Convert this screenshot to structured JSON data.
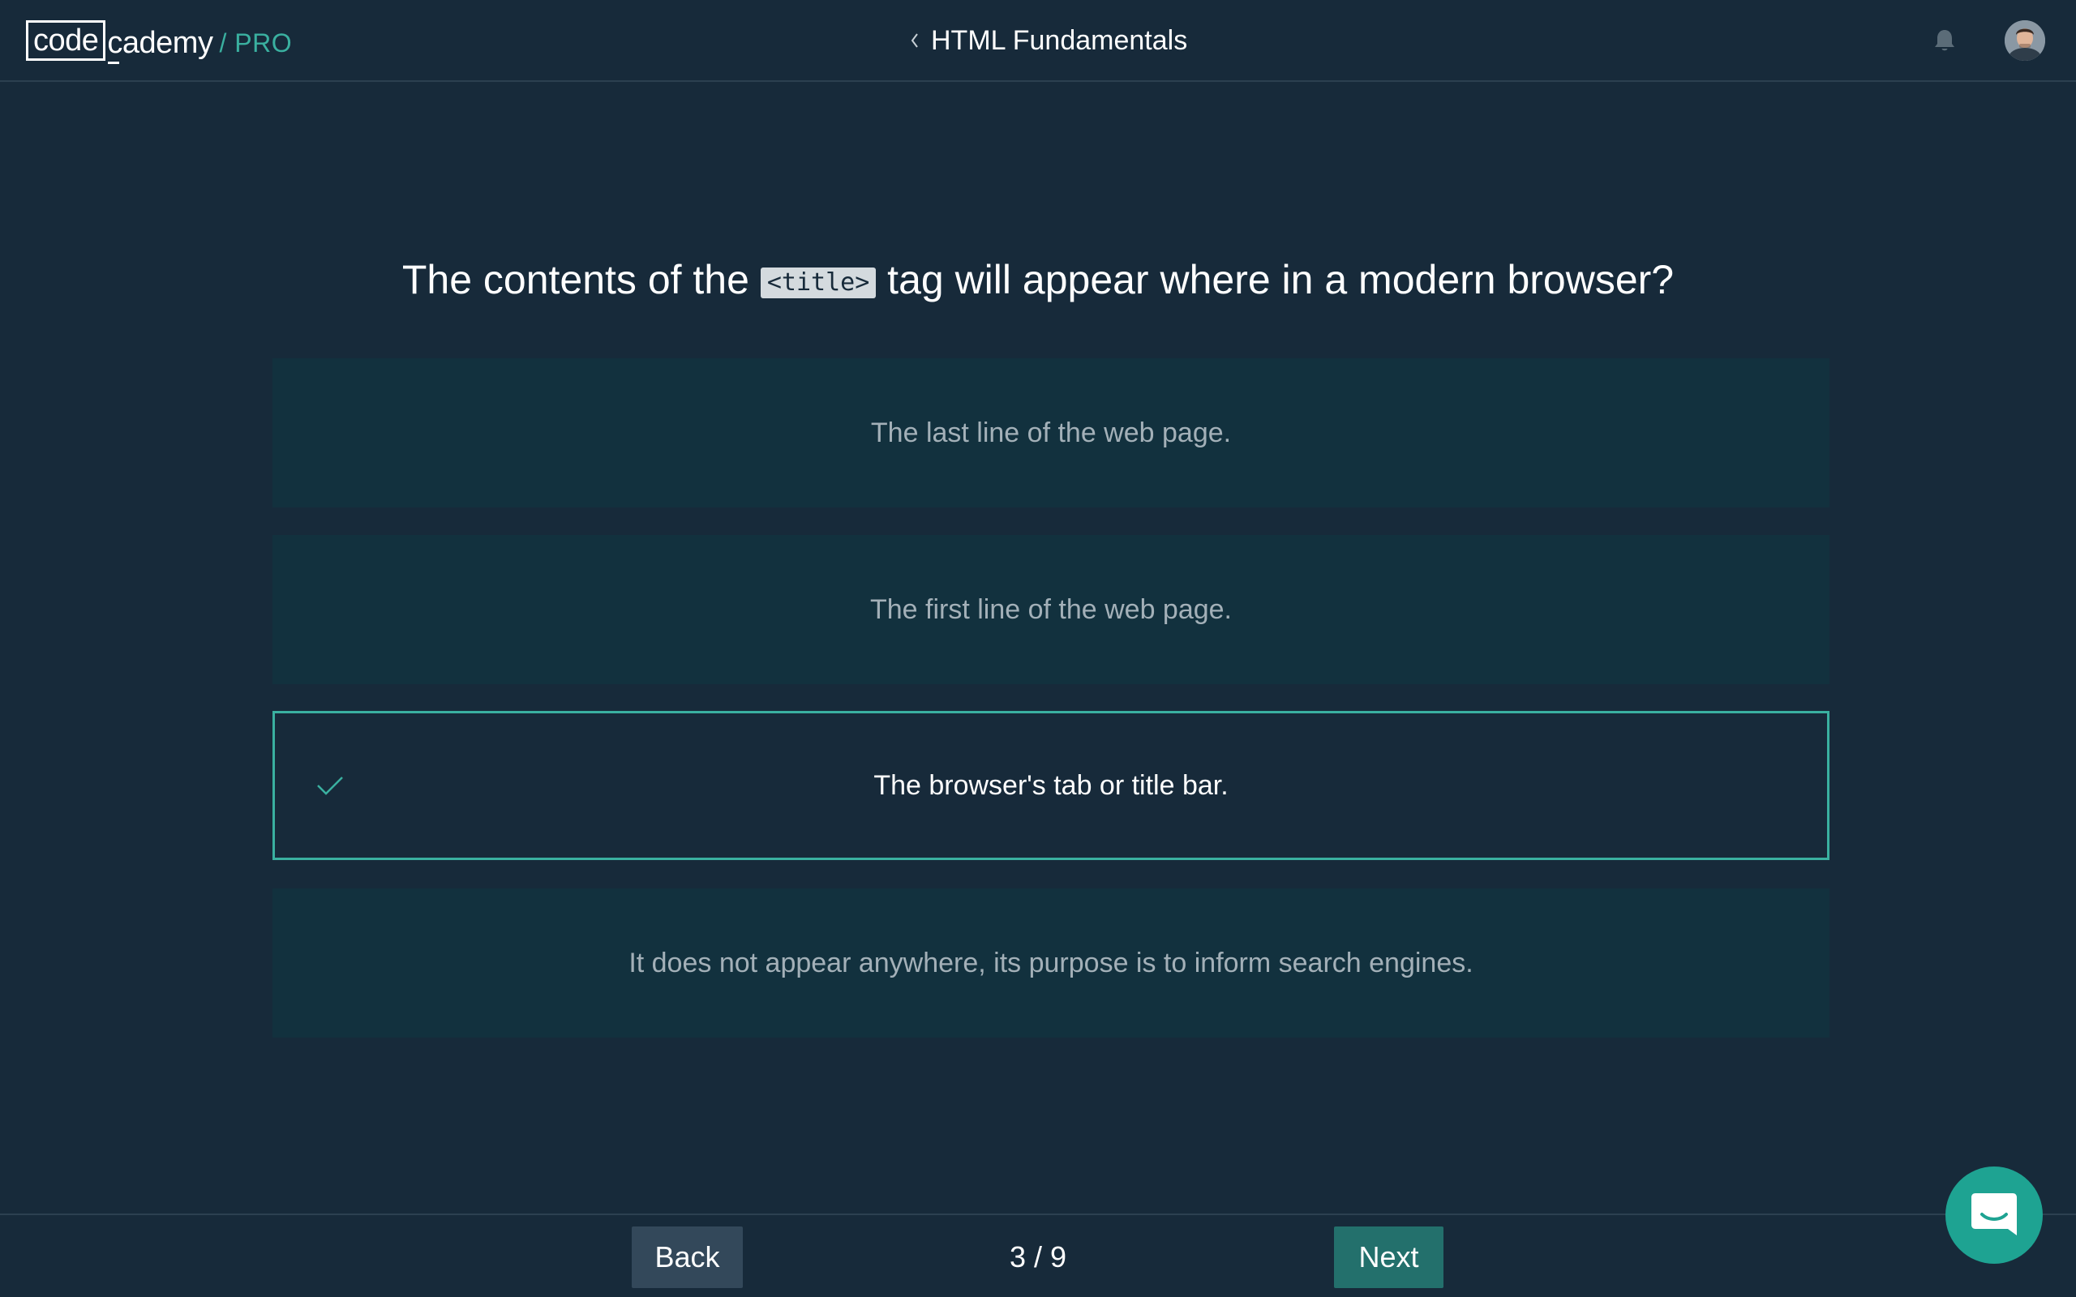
{
  "header": {
    "logo_box_text": "code",
    "logo_rest_text": "cademy",
    "logo_pro_text": "/ PRO",
    "course_title": "HTML Fundamentals"
  },
  "question": {
    "prefix": "The contents of the",
    "code": "<title>",
    "suffix": "tag will appear where in a modern browser?"
  },
  "answers": [
    {
      "label": "The last line of the web page.",
      "selected": false
    },
    {
      "label": "The first line of the web page.",
      "selected": false
    },
    {
      "label": "The browser's tab or title bar.",
      "selected": true
    },
    {
      "label": "It does not appear anywhere, its purpose is to inform search engines.",
      "selected": false
    }
  ],
  "footer": {
    "back_label": "Back",
    "progress": "3 / 9",
    "next_label": "Next"
  },
  "colors": {
    "background": "#172a3a",
    "answer_background": "#12313e",
    "accent": "#3ab0a0",
    "next_button": "#23706c",
    "back_button": "#33485a",
    "chat_bubble": "#1ea392"
  },
  "icons": {
    "back": "chevron-left-icon",
    "notifications": "bell-icon",
    "selected_answer": "checkmark-icon",
    "support": "chat-icon"
  }
}
